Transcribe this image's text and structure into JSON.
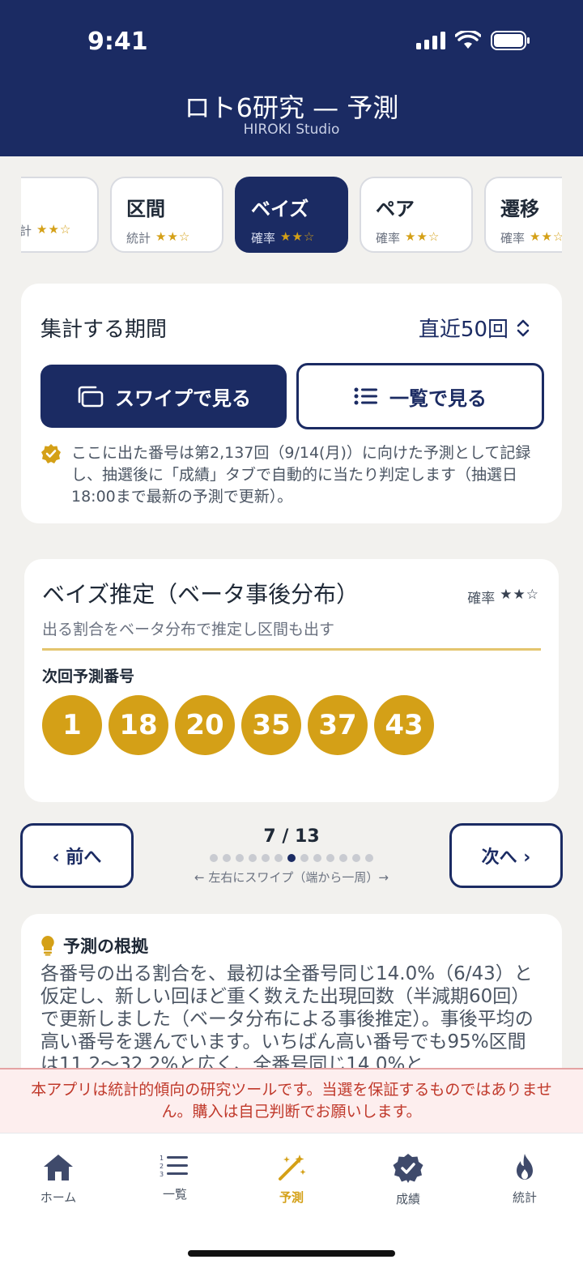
{
  "status": {
    "time": "9:41"
  },
  "header": {
    "title": "ロト6研究 — 予測",
    "subtitle": "HIROKI Studio"
  },
  "tabs": [
    {
      "name": "",
      "category": "計",
      "stars": "★★☆"
    },
    {
      "name": "区間",
      "category": "統計",
      "stars": "★★☆"
    },
    {
      "name": "ベイズ",
      "category": "確率",
      "stars": "★★☆",
      "active": true
    },
    {
      "name": "ペア",
      "category": "確率",
      "stars": "★★☆"
    },
    {
      "name": "遷移",
      "category": "確率",
      "stars": "★★☆"
    }
  ],
  "period": {
    "label": "集計する期間",
    "value": "直近50回",
    "swipe_button": "スワイプで見る",
    "list_button": "一覧で見る",
    "note": "ここに出た番号は第2,137回（9/14(月)）に向けた予測として記録し、抽選後に「成績」タブで自動的に当たり判定します（抽選日18:00まで最新の予測で更新）。"
  },
  "method": {
    "title": "ベイズ推定（ベータ事後分布）",
    "rating_label": "確率",
    "rating_stars": "★★☆",
    "description": "出る割合をベータ分布で推定し区間も出す",
    "next_label": "次回予測番号",
    "numbers": [
      "1",
      "18",
      "20",
      "35",
      "37",
      "43"
    ]
  },
  "pager": {
    "prev": "‹ 前へ",
    "next": "次へ ›",
    "count": "7 / 13",
    "current": 7,
    "total": 13,
    "hint": "← 左右にスワイプ（端から一周）→"
  },
  "reason": {
    "title": "予測の根拠",
    "body": "各番号の出る割合を、最初は全番号同じ14.0%（6/43）と仮定し、新しい回ほど重く数えた出現回数（半減期60回）で更新しました（ベータ分布による事後推定）。事後平均の高い番号を選んでいます。いちばん高い番号でも95%区間は11.2〜32.2%と広く、全番号同じ14.0%と"
  },
  "disclaimer": "本アプリは統計的傾向の研究ツールです。当選を保証するものではありません。購入は自己判断でお願いします。",
  "nav": [
    {
      "label": "ホーム",
      "icon": "home-icon"
    },
    {
      "label": "一覧",
      "icon": "list-icon"
    },
    {
      "label": "予測",
      "icon": "magic-wand-icon",
      "active": true
    },
    {
      "label": "成績",
      "icon": "check-badge-icon"
    },
    {
      "label": "統計",
      "icon": "flame-icon"
    }
  ],
  "colors": {
    "navy": "#1b2b63",
    "gold": "#d4a017",
    "danger": "#c0392b"
  }
}
